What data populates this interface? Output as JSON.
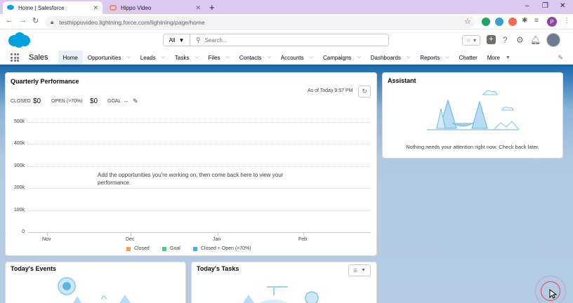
{
  "browser": {
    "tabs": [
      {
        "title": "Home | Salesforce"
      },
      {
        "title": "Hippo Video"
      }
    ],
    "url": "testhippovideo.lightning.force.com/lightning/page/home",
    "window_controls": [
      "–",
      "❐",
      "✕"
    ],
    "profile_initial": "P"
  },
  "header": {
    "search_scope": "All",
    "search_placeholder": "Search..."
  },
  "nav": {
    "app_name": "Sales",
    "items": [
      {
        "label": "Home",
        "chev": false
      },
      {
        "label": "Opportunities",
        "chev": true
      },
      {
        "label": "Leads",
        "chev": true
      },
      {
        "label": "Tasks",
        "chev": true
      },
      {
        "label": "Files",
        "chev": true
      },
      {
        "label": "Contacts",
        "chev": true
      },
      {
        "label": "Accounts",
        "chev": true
      },
      {
        "label": "Campaigns",
        "chev": true
      },
      {
        "label": "Dashboards",
        "chev": true
      },
      {
        "label": "Reports",
        "chev": true
      },
      {
        "label": "Chatter",
        "chev": false
      },
      {
        "label": "More",
        "chev": true
      }
    ]
  },
  "performance": {
    "title": "Quarterly Performance",
    "as_of": "As of Today 9:57 PM",
    "closed_label": "CLOSED",
    "closed_value": "$0",
    "open_label": "OPEN (>70%)",
    "open_value": "$0",
    "goal_label": "GOAL",
    "goal_value": "--",
    "empty_message": "Add the opportunities you're working on, then come back here to view your performance."
  },
  "chart_data": {
    "type": "line",
    "x": [
      "Nov",
      "Dec",
      "Jan",
      "Feb"
    ],
    "yticks": [
      "500k",
      "400k",
      "300k",
      "200k",
      "100k",
      "0"
    ],
    "ylim": [
      0,
      500000
    ],
    "series": [
      {
        "name": "Closed",
        "values": []
      },
      {
        "name": "Goal",
        "values": []
      },
      {
        "name": "Closed + Open (>70%)",
        "values": []
      }
    ],
    "colors": [
      "#f4a156",
      "#4bca81",
      "#54a8e0"
    ],
    "grid": true,
    "legend": "bottom"
  },
  "assistant": {
    "title": "Assistant",
    "message": "Nothing needs your attention right now. Check back later."
  },
  "events": {
    "title": "Today's Events"
  },
  "tasks": {
    "title": "Today's Tasks"
  }
}
